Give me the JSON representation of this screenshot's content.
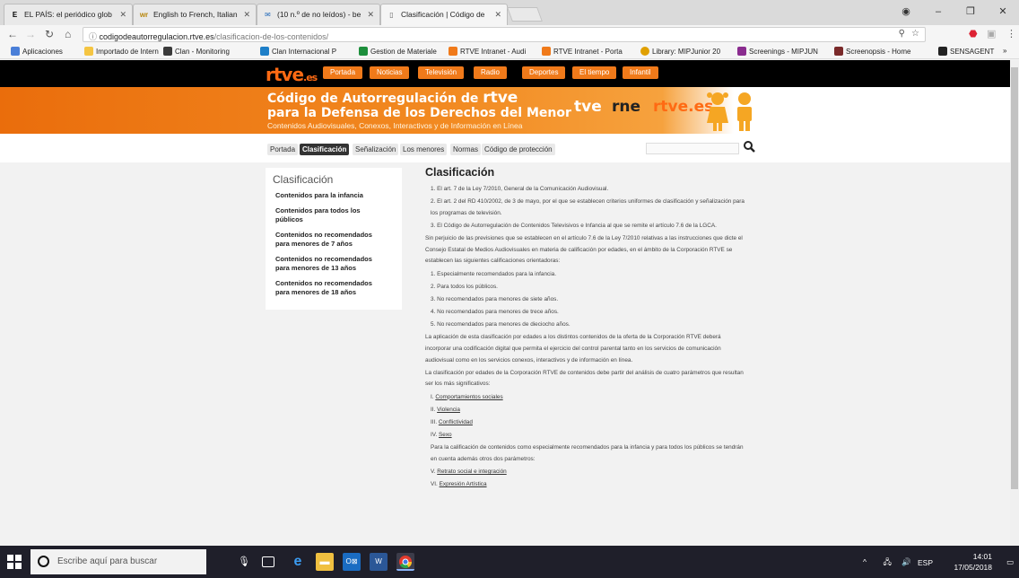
{
  "browser": {
    "tabs": [
      {
        "title": "EL PAÍS: el periódico glob",
        "icon": "E"
      },
      {
        "title": "English to French, Italian",
        "icon": "wr"
      },
      {
        "title": "(10 n.º de no leídos) - be",
        "icon": "mail-icon"
      },
      {
        "title": "Clasificación | Código de",
        "icon": "page-icon"
      }
    ],
    "url_host": "codigodeautorregulacion.rtve.es",
    "url_path": "/clasificacion-de-los-contenidos/",
    "bookmarks": [
      "Aplicaciones",
      "Importado de Intern",
      "Clan - Monitoring",
      "Clan Internacional P",
      "Gestion de Materiale",
      "RTVE Intranet - Audi",
      "RTVE Intranet - Porta",
      "Library: MIPJunior 20",
      "Screenings - MIPJUN",
      "Screenopsis - Home",
      "SENSAGENT",
      "»"
    ]
  },
  "site": {
    "logo": "rtve",
    "logo_suffix": ".es",
    "top_nav": [
      "Portada",
      "Noticias",
      "Televisión",
      "Radio",
      "Deportes",
      "El tiempo",
      "Infantil"
    ],
    "banner_line1": "Código de Autorregulación de",
    "banner_brand": "rtve",
    "banner_line2": "para la Defensa de los Derechos del Menor",
    "banner_sub": "Contenidos Audiovisuales, Conexos, Interactivos y de Información en Línea",
    "banner_logos": [
      "tve",
      "rne",
      "rtve.es"
    ],
    "sub_nav": [
      "Portada",
      "Clasificación",
      "Señalización",
      "Los menores",
      "Normas",
      "Código de protección"
    ],
    "sub_nav_active": "Clasificación"
  },
  "sidebar": {
    "title": "Clasificación",
    "items": [
      "Contenidos para la infancia",
      "Contenidos para todos los públicos",
      "Contenidos no recomendados para menores de 7 años",
      "Contenidos no recomendados para menores de 13 años",
      "Contenidos no recomendados para menores de 18 años"
    ]
  },
  "content": {
    "title": "Clasificación",
    "p1": "1. El art. 7 de la Ley 7/2010, General de la Comunicación Audiovisual.",
    "p2": "2. El art. 2 del RD 410/2002, de 3 de mayo, por el que se establecen criterios uniformes de clasificación y señalización para los programas de televisión.",
    "p3": "3. El Código de Autorregulación de Contenidos Televisivos e Infancia al que se remite el artículo 7.6 de la LGCA.",
    "p4": "Sin perjuicio de las previsiones que se establecen en el artículo 7.6 de la Ley 7/2010 relativas a las instrucciones que dicte el Consejo Estatal de Medios Audiovisuales en materia de calificación por edades, en el ámbito de la Corporación RTVE se establecen las siguientes calificaciones orientadoras:",
    "list": [
      "1. Especialmente recomendados para la infancia.",
      "2. Para todos los públicos.",
      "3. No recomendados para menores de siete años.",
      "4. No recomendados para menores de trece años.",
      "5. No recomendados para menores de dieciocho años."
    ],
    "p5": "La aplicación de esta clasificación por edades a los distintos contenidos de la oferta de la Corporación RTVE deberá incorporar una codificación digital que permita el ejercicio del control parental tanto en los servicios de comunicación audiovisual como en los servicios conexos, interactivos y de información en línea.",
    "p6": "La clasificación por edades de la Corporación RTVE de contenidos debe partir del análisis de cuatro parámetros que resultan ser los más significativos:",
    "params": [
      {
        "num": "I.",
        "label": "Comportamientos sociales"
      },
      {
        "num": "II.",
        "label": "Violencia"
      },
      {
        "num": "III.",
        "label": "Conflictividad"
      },
      {
        "num": "IV.",
        "label": "Sexo"
      }
    ],
    "p7": "Para la calificación de contenidos como especialmente recomendados para la infancia y para todos los públicos se tendrán en cuenta además otros dos parámetros:",
    "params2": [
      {
        "num": "V.",
        "label": "Retrato social e integración"
      },
      {
        "num": "VI.",
        "label": "Expresión Artística"
      }
    ]
  },
  "taskbar": {
    "search_placeholder": "Escribe aquí para buscar",
    "lang": "ESP",
    "time": "14:01",
    "date": "17/05/2018"
  }
}
